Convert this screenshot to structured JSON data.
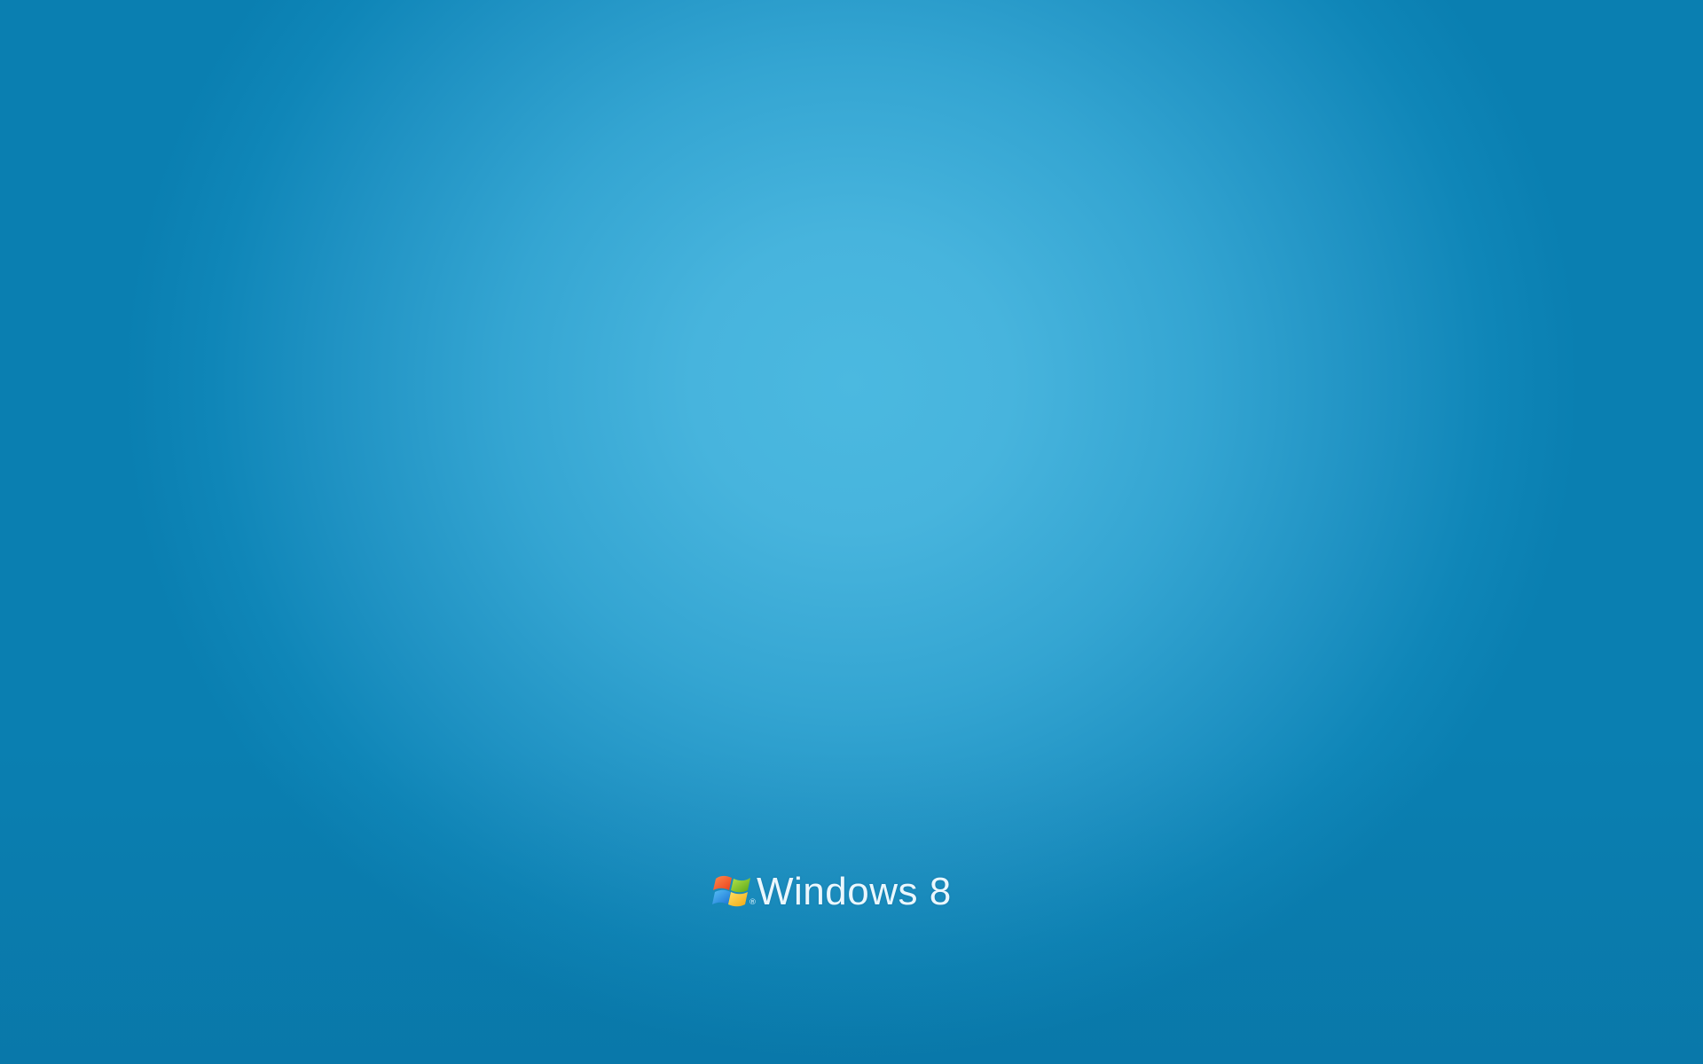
{
  "desktop": {
    "background": {
      "center_color": "#4bb9e0",
      "edge_color": "#0a7fb1"
    },
    "branding": {
      "logo_icon": "windows-flag-icon",
      "registered_mark": "®",
      "product_name": "Windows 8",
      "text_color": "#eaf7fd"
    }
  }
}
